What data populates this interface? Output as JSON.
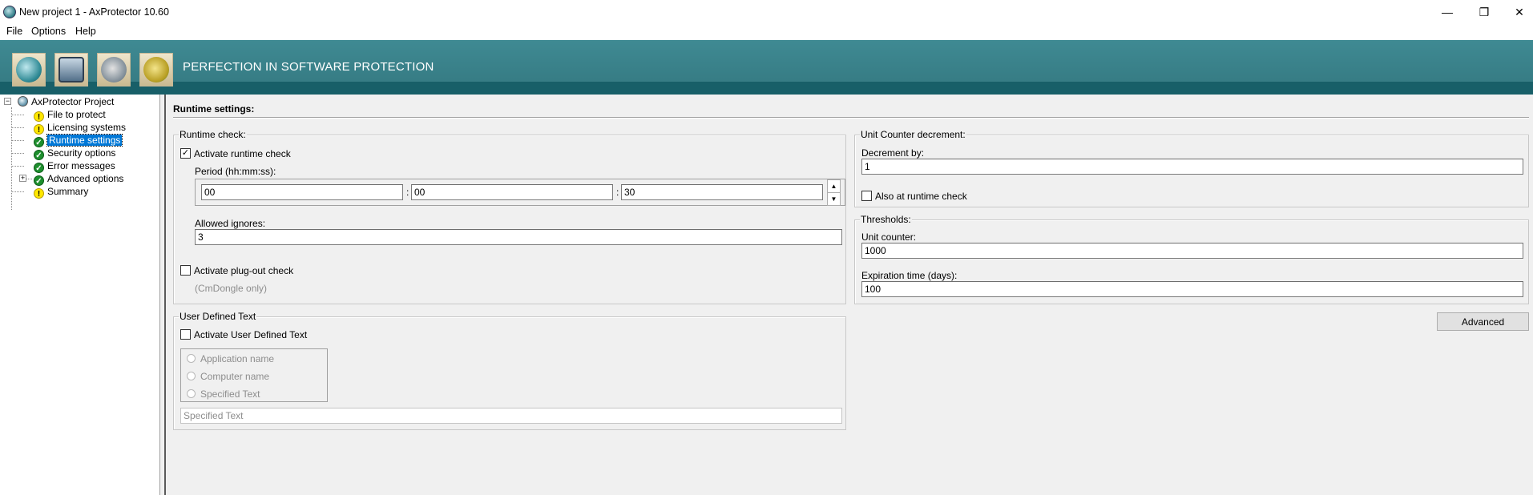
{
  "window": {
    "title": "New project 1 - AxProtector 10.60",
    "controls": {
      "minimize": "—",
      "restore": "❐",
      "close": "✕"
    }
  },
  "menu": [
    "File",
    "Options",
    "Help"
  ],
  "banner": {
    "tagline": "PERFECTION IN SOFTWARE PROTECTION",
    "toolbar_icons": [
      "run-icon",
      "settings-screen-icon",
      "dongle-icon",
      "gear-icon"
    ]
  },
  "tree": {
    "root": "AxProtector Project",
    "items": [
      {
        "label": "File to protect",
        "status": "warning"
      },
      {
        "label": "Licensing systems",
        "status": "warning"
      },
      {
        "label": "Runtime settings",
        "status": "ok",
        "selected": true
      },
      {
        "label": "Security options",
        "status": "ok"
      },
      {
        "label": "Error messages",
        "status": "ok"
      },
      {
        "label": "Advanced options",
        "status": "ok",
        "expandable": true
      },
      {
        "label": "Summary",
        "status": "warning"
      }
    ]
  },
  "content": {
    "title": "Runtime settings:",
    "runtime_check": {
      "legend": "Runtime check:",
      "activate_label": "Activate runtime check",
      "activate_checked": true,
      "period_label": "Period (hh:mm:ss):",
      "hours": "00",
      "minutes": "00",
      "seconds": "30",
      "separator": ":",
      "allowed_ignores_label": "Allowed ignores:",
      "allowed_ignores": "3",
      "plugout_label": "Activate plug-out check",
      "plugout_checked": false,
      "plugout_note": "(CmDongle only)"
    },
    "user_defined_text": {
      "legend": "User Defined Text",
      "activate_label": "Activate User Defined Text",
      "activate_checked": false,
      "options": [
        "Application name",
        "Computer name",
        "Specified Text"
      ],
      "text_value": "Specified Text"
    },
    "unit_counter": {
      "legend": "Unit Counter decrement:",
      "decrement_label": "Decrement by:",
      "decrement_value": "1",
      "also_runtime_label": "Also at runtime check",
      "also_runtime_checked": false
    },
    "thresholds": {
      "legend": "Thresholds:",
      "unit_counter_label": "Unit counter:",
      "unit_counter_value": "1000",
      "expiration_label": "Expiration time (days):",
      "expiration_value": "100"
    },
    "advanced_button": "Advanced"
  }
}
